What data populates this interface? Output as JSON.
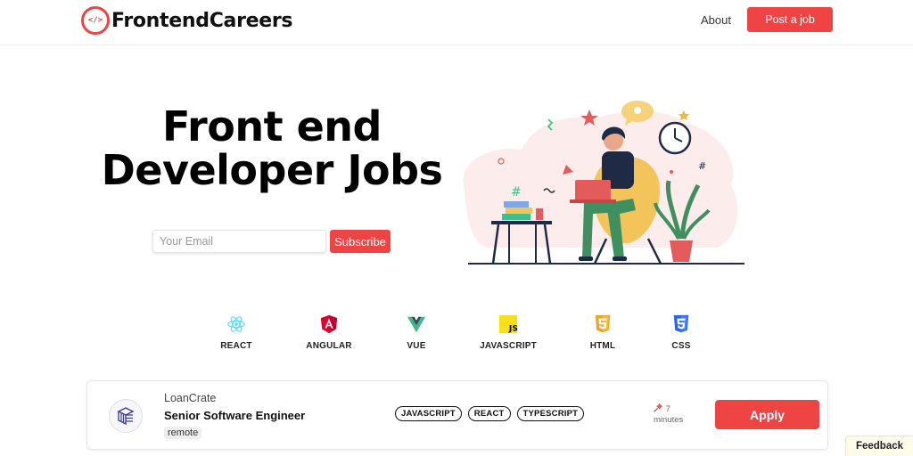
{
  "header": {
    "logo_mark": "</>",
    "logo_text": "FrontendCareers",
    "nav_about": "About",
    "post_job_label": "Post a job"
  },
  "hero": {
    "title_line1": "Front end",
    "title_line2": "Developer Jobs",
    "email_placeholder": "Your Email",
    "subscribe_label": "Subscribe"
  },
  "categories": [
    {
      "label": "REACT",
      "icon": "react-icon",
      "color": "#61dafb"
    },
    {
      "label": "ANGULAR",
      "icon": "angular-icon",
      "color": "#dd0031"
    },
    {
      "label": "VUE",
      "icon": "vue-icon",
      "color": "#41b883"
    },
    {
      "label": "JAVASCRIPT",
      "icon": "javascript-icon",
      "color": "#f7df1e"
    },
    {
      "label": "HTML",
      "icon": "html5-icon",
      "color": "#e8a727"
    },
    {
      "label": "CSS",
      "icon": "css3-icon",
      "color": "#2965f1"
    }
  ],
  "job": {
    "company": "LoanCrate",
    "title": "Senior Software Engineer",
    "location": "remote",
    "tags": [
      "JAVASCRIPT",
      "REACT",
      "TYPESCRIPT"
    ],
    "posted_value": "7",
    "posted_unit": "minutes",
    "apply_label": "Apply"
  },
  "feedback_label": "Feedback",
  "colors": {
    "accent": "#ef4444",
    "illustration_blob": "#fdecec",
    "illustration_shirt": "#1f2a44",
    "illustration_pants": "#3f8f5f",
    "illustration_chair": "#f3c45a"
  }
}
